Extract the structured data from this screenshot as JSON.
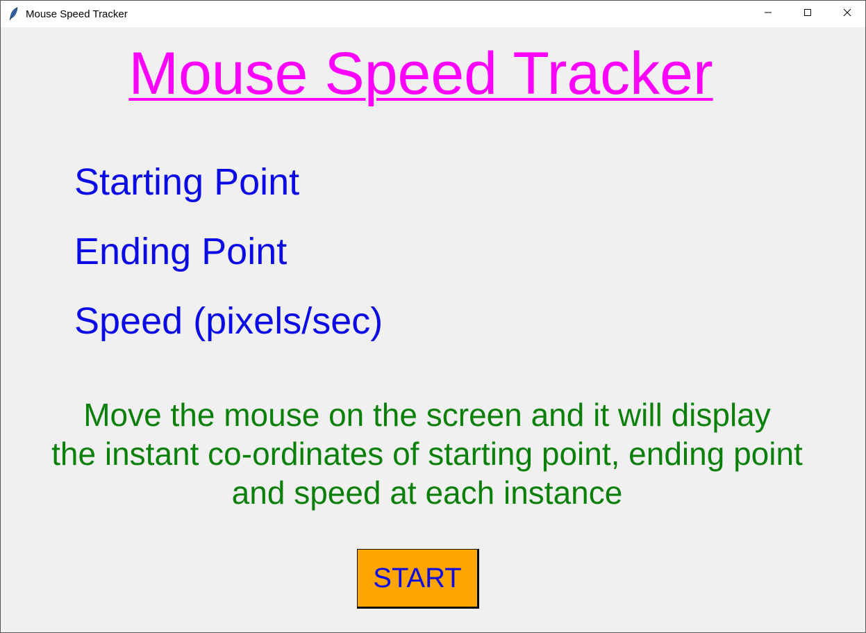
{
  "window": {
    "title": "Mouse Speed Tracker",
    "icons": {
      "app": "feather-icon",
      "minimize": "minimize-icon",
      "maximize": "maximize-icon",
      "close": "close-icon"
    }
  },
  "main": {
    "heading": "Mouse Speed Tracker",
    "labels": {
      "starting_point": "Starting Point",
      "ending_point": "Ending Point",
      "speed": "Speed (pixels/sec)"
    },
    "instructions": [
      "Move the mouse on the screen and it will display",
      "the instant co-ordinates of starting point, ending point",
      "and speed at each instance"
    ],
    "start_button": "START"
  },
  "colors": {
    "background": "#f0f0f0",
    "heading": "#ff00ff",
    "labels": "#0a0ae6",
    "instructions": "#0a800a",
    "button_bg": "#ffa500",
    "button_text": "#0a0ae6"
  }
}
